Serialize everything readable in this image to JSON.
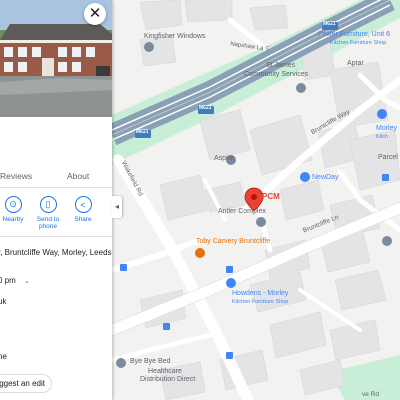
{
  "panel": {
    "close_label": "✕",
    "tabs": [
      {
        "label": "Reviews"
      },
      {
        "label": "About"
      }
    ],
    "actions": [
      {
        "label": "Nearby",
        "icon": "nearby-icon"
      },
      {
        "label": "Send to phone",
        "icon": "send-to-phone-icon"
      },
      {
        "label": "Share",
        "icon": "share-icon"
      }
    ],
    "address": "r, Bruntcliffe Way, Morley, Leeds",
    "hours": "0 pm",
    "website": "uk",
    "phone": "ne",
    "suggest_edit_label": "ggest an edit"
  },
  "map": {
    "place": {
      "name": "PCM",
      "marker_color": "#ea4335"
    },
    "labels": {
      "kingfisher": "Kingfisher Windows",
      "napshaw": "Napshaw La S",
      "m621_a": "M621",
      "m621_b": "M621",
      "m621_c": "M621",
      "st_james": "St James",
      "community": "Community Services",
      "power_furniture": "Power Furniture, Unit 6",
      "kitchen_furniture_shop": "Kitchen Furniture Shop",
      "aptar": "Aptar",
      "bruntcliffe_way": "Bruntcliffe Way",
      "morley": "Morley",
      "kitchen": "Kitch",
      "parcel": "Parcel",
      "aspire": "Aspire",
      "newday": "NewDay",
      "wakefield_rd": "Wakefield Rd",
      "antler": "Antler Complex",
      "bruntcliffe_ln": "Bruntcliffe Ln",
      "toby": "Toby Carvery Bruntcliffe",
      "howdens": "Howdens - Morley",
      "howdens_sub": "Kitchen Furniture Shop",
      "byebye": "Bye Bye Bed",
      "healthcare": "Healthcare",
      "distribution": "Distribution Direct",
      "bottom_road": "ve Rd"
    },
    "colors": {
      "land": "#f2f2f0",
      "building": "#e4e4e6",
      "motorway": "#8aa0b4",
      "green": "#c8eed8",
      "road": "#ffffff",
      "poi_text": "#5f6368",
      "food": "#e8710a",
      "shop": "#4285f4"
    }
  }
}
